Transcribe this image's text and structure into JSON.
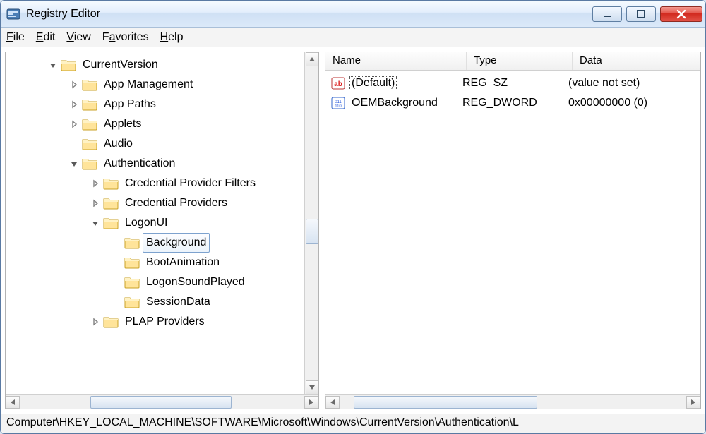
{
  "window": {
    "title": "Registry Editor"
  },
  "menu": {
    "file": "File",
    "edit": "Edit",
    "view": "View",
    "favorites": "Favorites",
    "help": "Help"
  },
  "tree": {
    "nodes": [
      {
        "label": "CurrentVersion",
        "indent": 56,
        "expander": "open",
        "selected": false
      },
      {
        "label": "App Management",
        "indent": 86,
        "expander": "closed",
        "selected": false
      },
      {
        "label": "App Paths",
        "indent": 86,
        "expander": "closed",
        "selected": false
      },
      {
        "label": "Applets",
        "indent": 86,
        "expander": "closed",
        "selected": false
      },
      {
        "label": "Audio",
        "indent": 86,
        "expander": "none",
        "selected": false
      },
      {
        "label": "Authentication",
        "indent": 86,
        "expander": "open",
        "selected": false
      },
      {
        "label": "Credential Provider Filters",
        "indent": 116,
        "expander": "closed",
        "selected": false
      },
      {
        "label": "Credential Providers",
        "indent": 116,
        "expander": "closed",
        "selected": false
      },
      {
        "label": "LogonUI",
        "indent": 116,
        "expander": "open",
        "selected": false
      },
      {
        "label": "Background",
        "indent": 146,
        "expander": "none",
        "selected": true
      },
      {
        "label": "BootAnimation",
        "indent": 146,
        "expander": "none",
        "selected": false
      },
      {
        "label": "LogonSoundPlayed",
        "indent": 146,
        "expander": "none",
        "selected": false
      },
      {
        "label": "SessionData",
        "indent": 146,
        "expander": "none",
        "selected": false
      },
      {
        "label": "PLAP Providers",
        "indent": 116,
        "expander": "closed",
        "selected": false
      }
    ]
  },
  "list": {
    "columns": {
      "name": "Name",
      "type": "Type",
      "data": "Data"
    },
    "rows": [
      {
        "icon": "string",
        "name": "(Default)",
        "type": "REG_SZ",
        "data": "(value not set)",
        "focused": true
      },
      {
        "icon": "binary",
        "name": "OEMBackground",
        "type": "REG_DWORD",
        "data": "0x00000000 (0)",
        "focused": false
      }
    ]
  },
  "statusbar": {
    "path": "Computer\\HKEY_LOCAL_MACHINE\\SOFTWARE\\Microsoft\\Windows\\CurrentVersion\\Authentication\\L"
  }
}
